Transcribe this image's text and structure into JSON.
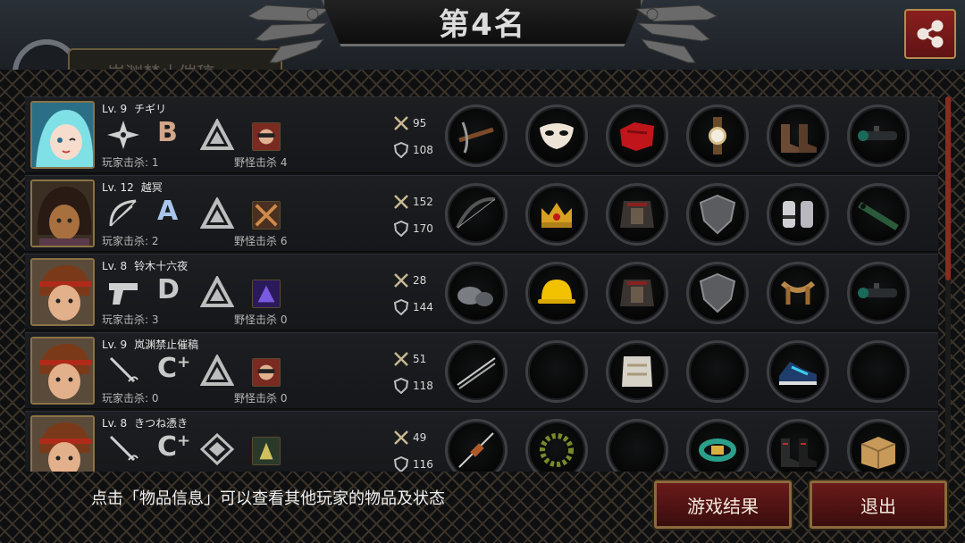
{
  "header": {
    "rank_title": "第4名",
    "ghost_label": "岚渊禁止催稿"
  },
  "players": [
    {
      "level": "Lv. 9",
      "name": "チギリ",
      "grade": "B",
      "grade_plus": "",
      "player_kills": "玩家击杀: 1",
      "monster_kills": "野怪击杀 4",
      "attack": "95",
      "defense": "108",
      "weapon_icon": "shuriken-icon",
      "items": [
        "crossbow-icon",
        "mask-icon",
        "red-cloth-icon",
        "wristwatch-icon",
        "boots-icon",
        "scope-icon"
      ]
    },
    {
      "level": "Lv. 12",
      "name": "越冥",
      "grade": "A",
      "grade_plus": "",
      "player_kills": "玩家击杀: 2",
      "monster_kills": "野怪击杀 6",
      "attack": "152",
      "defense": "170",
      "weapon_icon": "bow-icon",
      "items": [
        "longbow-icon",
        "crown-icon",
        "armor-icon",
        "shield-icon",
        "gauntlet-icon",
        "rifle-icon"
      ]
    },
    {
      "level": "Lv. 8",
      "name": "铃木十六夜",
      "grade": "D",
      "grade_plus": "",
      "player_kills": "玩家击杀: 3",
      "monster_kills": "野怪击杀 0",
      "attack": "28",
      "defense": "144",
      "weapon_icon": "pistol-icon",
      "items": [
        "stones-icon",
        "hardhat-icon",
        "armor-icon",
        "shield-icon",
        "harness-icon",
        "scope-icon"
      ]
    },
    {
      "level": "Lv. 9",
      "name": "岚渊禁止催稿",
      "grade": "C",
      "grade_plus": "+",
      "player_kills": "玩家击杀: 0",
      "monster_kills": "野怪击杀 0",
      "attack": "51",
      "defense": "118",
      "weapon_icon": "rapier-icon",
      "items": [
        "needles-icon",
        "empty-slot",
        "plate-armor-icon",
        "empty-slot",
        "sneaker-icon",
        "empty-slot"
      ]
    },
    {
      "level": "Lv. 8",
      "name": "きつね憑き",
      "grade": "C",
      "grade_plus": "+",
      "player_kills": "",
      "monster_kills": "",
      "attack": "49",
      "defense": "116",
      "weapon_icon": "rapier-icon",
      "items": [
        "syringe-icon",
        "laurel-icon",
        "empty-slot",
        "bracelet-icon",
        "boots-icon",
        "box-icon"
      ]
    }
  ],
  "footer": {
    "hint": "点击「物品信息」可以查看其他玩家的物品及状态",
    "result_button": "游戏结果",
    "exit_button": "退出"
  },
  "colors": {
    "accent_red": "#6b1a1a",
    "gold_border": "#8a6a3c",
    "slot_border": "#3d3f43"
  }
}
